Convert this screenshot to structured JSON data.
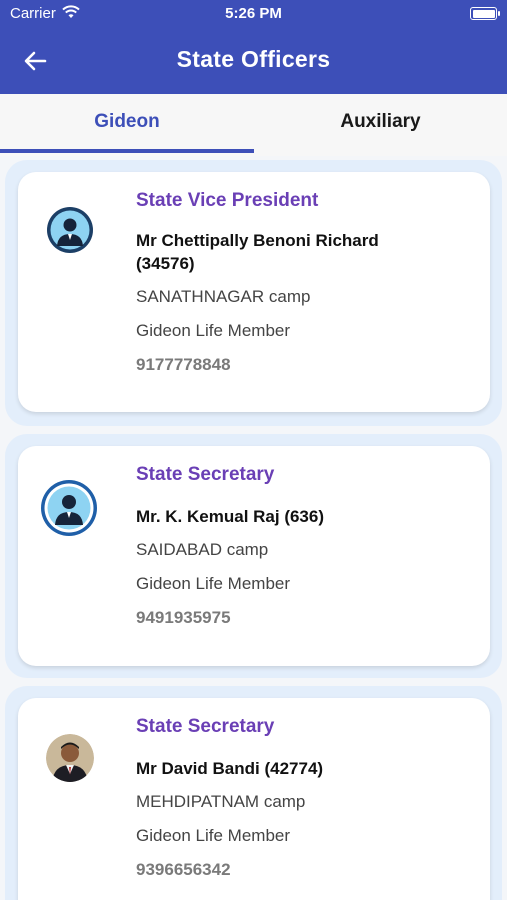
{
  "status_bar": {
    "carrier": "Carrier",
    "time": "5:26 PM"
  },
  "header": {
    "title": "State Officers"
  },
  "tabs": [
    {
      "label": "Gideon",
      "active": true
    },
    {
      "label": "Auxiliary",
      "active": false
    }
  ],
  "colors": {
    "primary": "#3d4fb8",
    "role": "#6a3fb5",
    "card_bg": "#e3eefb"
  },
  "officers": [
    {
      "role": "State Vice President",
      "name": "Mr  Chettipally Benoni Richard (34576)",
      "camp": "SANATHNAGAR camp",
      "membership": "Gideon Life Member",
      "phone": "9177778848",
      "avatar": "person-silhouette-icon"
    },
    {
      "role": "State Secretary",
      "name": "Mr. K. Kemual Raj (636)",
      "camp": "SAIDABAD camp",
      "membership": "Gideon Life Member",
      "phone": "9491935975",
      "avatar": "person-silhouette-icon"
    },
    {
      "role": "State Secretary",
      "name": "Mr David Bandi (42774)",
      "camp": "MEHDIPATNAM camp",
      "membership": "Gideon Life Member",
      "phone": "9396656342",
      "avatar": "photo"
    }
  ]
}
